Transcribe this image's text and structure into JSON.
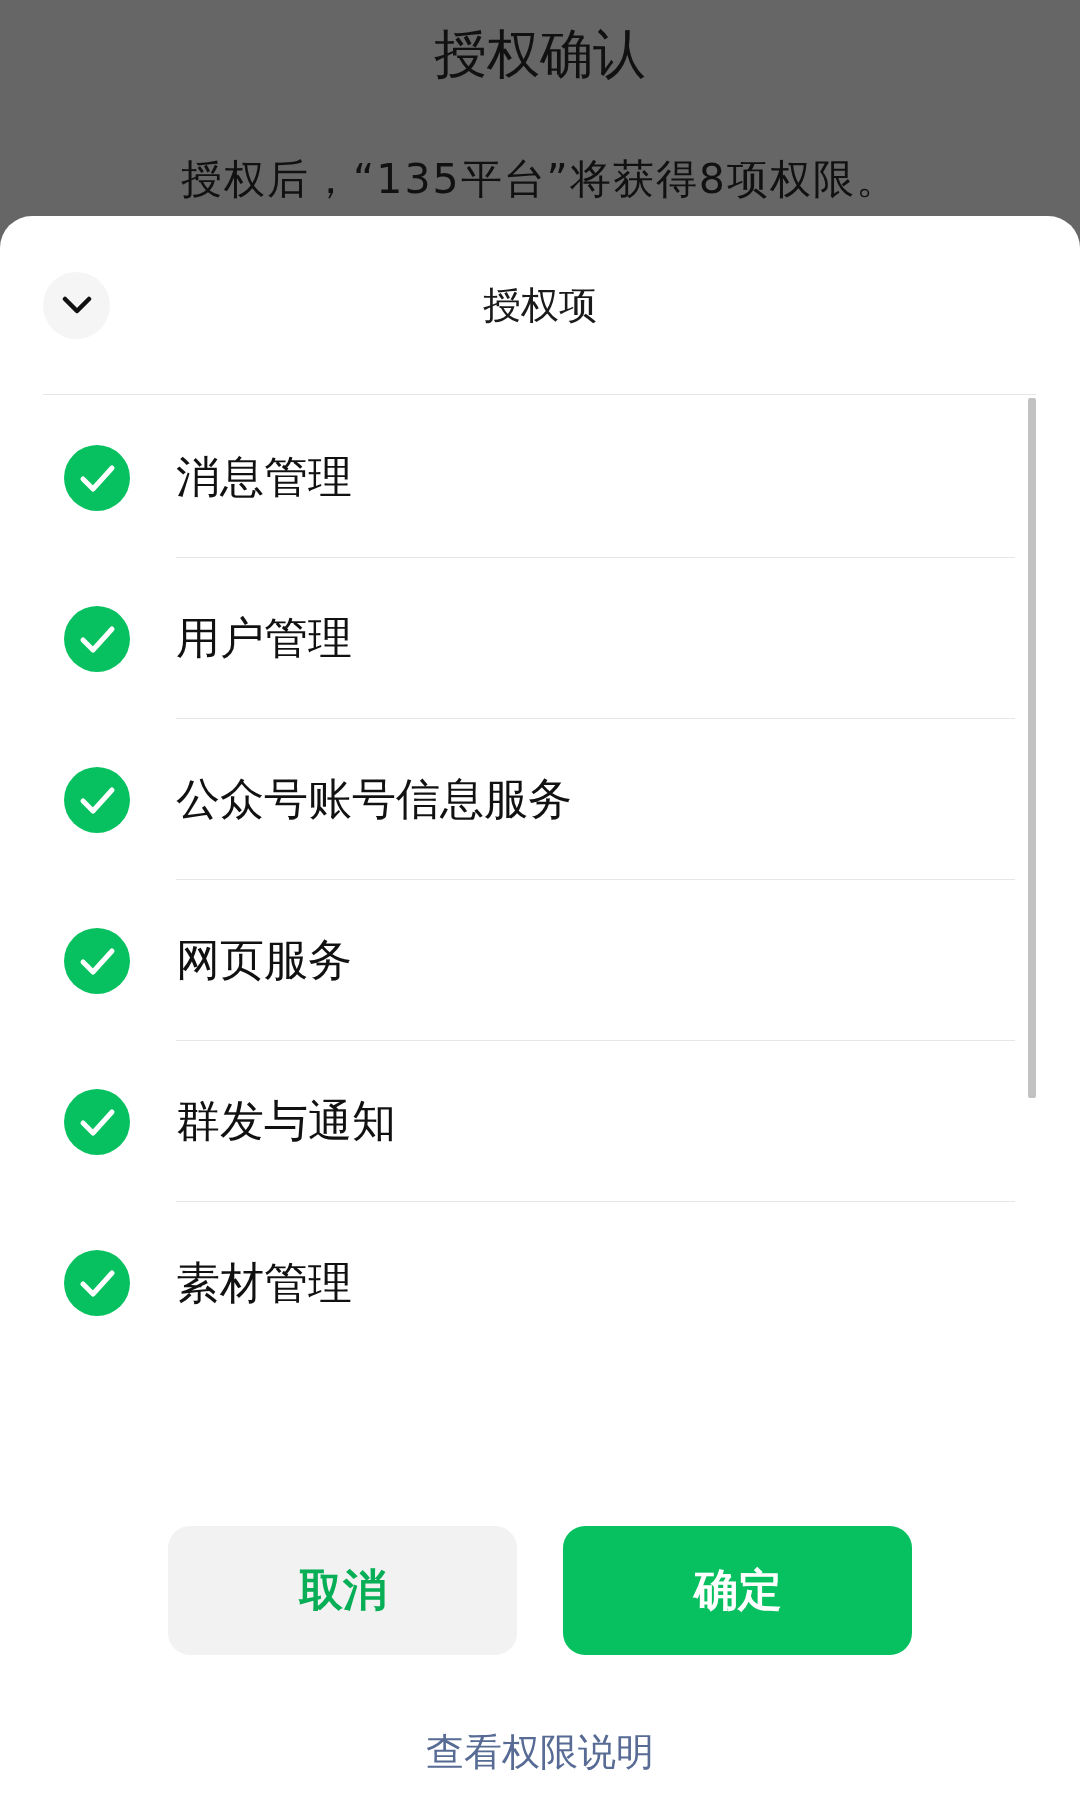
{
  "overlay": {
    "title": "授权确认",
    "subtitle": "授权后，“135平台”将获得8项权限。"
  },
  "sheet": {
    "title": "授权项",
    "items": [
      {
        "label": "消息管理",
        "checked": true
      },
      {
        "label": "用户管理",
        "checked": true
      },
      {
        "label": "公众号账号信息服务",
        "checked": true
      },
      {
        "label": "网页服务",
        "checked": true
      },
      {
        "label": "群发与通知",
        "checked": true
      },
      {
        "label": "素材管理",
        "checked": true
      }
    ],
    "buttons": [
      {
        "label": "取消",
        "kind": "secondary"
      },
      {
        "label": "确定",
        "kind": "primary"
      }
    ],
    "link": "查看权限说明"
  }
}
